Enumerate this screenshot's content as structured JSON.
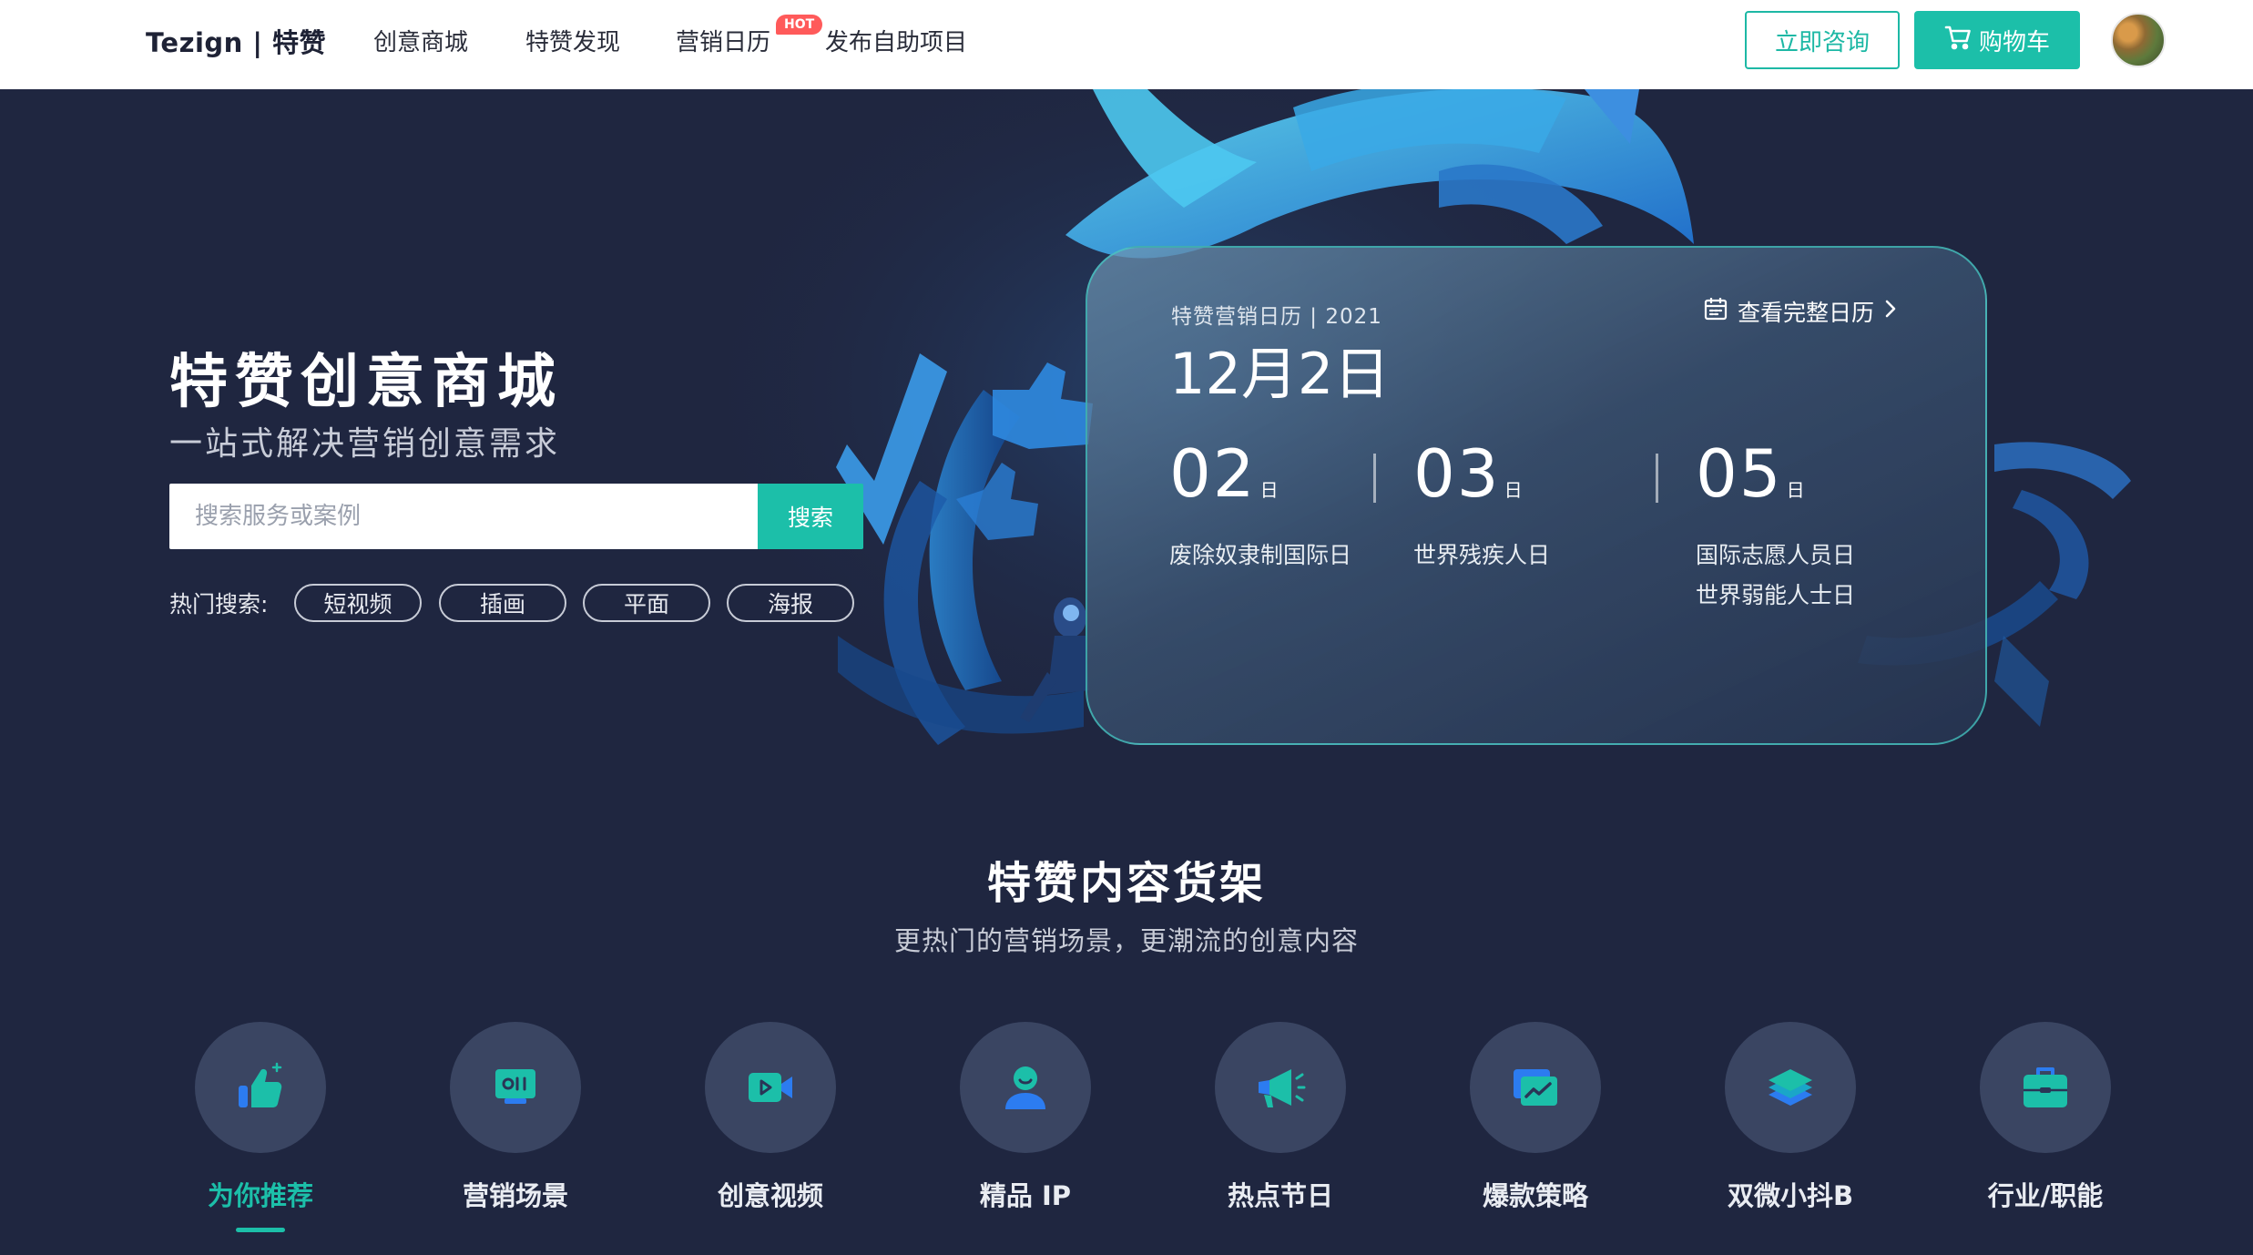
{
  "nav": {
    "logo": "Tezign | 特赞",
    "items": [
      "创意商城",
      "特赞发现",
      "营销日历",
      "发布自助项目"
    ],
    "hot_badge": "HOT",
    "consult_label": "立即咨询",
    "cart_label": "购物车"
  },
  "hero": {
    "title": "特赞创意商城",
    "subtitle": "一站式解决营销创意需求",
    "search": {
      "placeholder": "搜索服务或案例",
      "button_label": "搜索"
    },
    "hot_search_label": "热门搜索:",
    "hot_tags": [
      "短视频",
      "插画",
      "平面",
      "海报"
    ]
  },
  "calendar": {
    "header": "特赞营销日历 | 2021",
    "date": "12月2日",
    "view_full_label": "查看完整日历",
    "day_unit": "日",
    "days": [
      {
        "day": "02",
        "events": [
          "废除奴隶制国际日"
        ]
      },
      {
        "day": "03",
        "events": [
          "世界残疾人日"
        ]
      },
      {
        "day": "05",
        "events": [
          "国际志愿人员日",
          "世界弱能人士日"
        ]
      }
    ]
  },
  "shelf": {
    "title": "特赞内容货架",
    "subtitle": "更热门的营销场景，更潮流的创意内容",
    "categories": [
      {
        "label": "为你推荐",
        "icon": "thumbs-up-icon",
        "active": true
      },
      {
        "label": "营销场景",
        "icon": "screen-icon"
      },
      {
        "label": "创意视频",
        "icon": "video-camera-icon"
      },
      {
        "label": "精品 IP",
        "icon": "person-icon"
      },
      {
        "label": "热点节日",
        "icon": "megaphone-icon"
      },
      {
        "label": "爆款策略",
        "icon": "trend-chart-icon"
      },
      {
        "label": "双微小抖B",
        "icon": "layers-icon"
      },
      {
        "label": "行业/职能",
        "icon": "briefcase-icon"
      }
    ]
  },
  "colors": {
    "accent": "#1cbfa9",
    "background": "#1f2640",
    "hot": "#ff5a5a",
    "circle": "#3a4562"
  }
}
